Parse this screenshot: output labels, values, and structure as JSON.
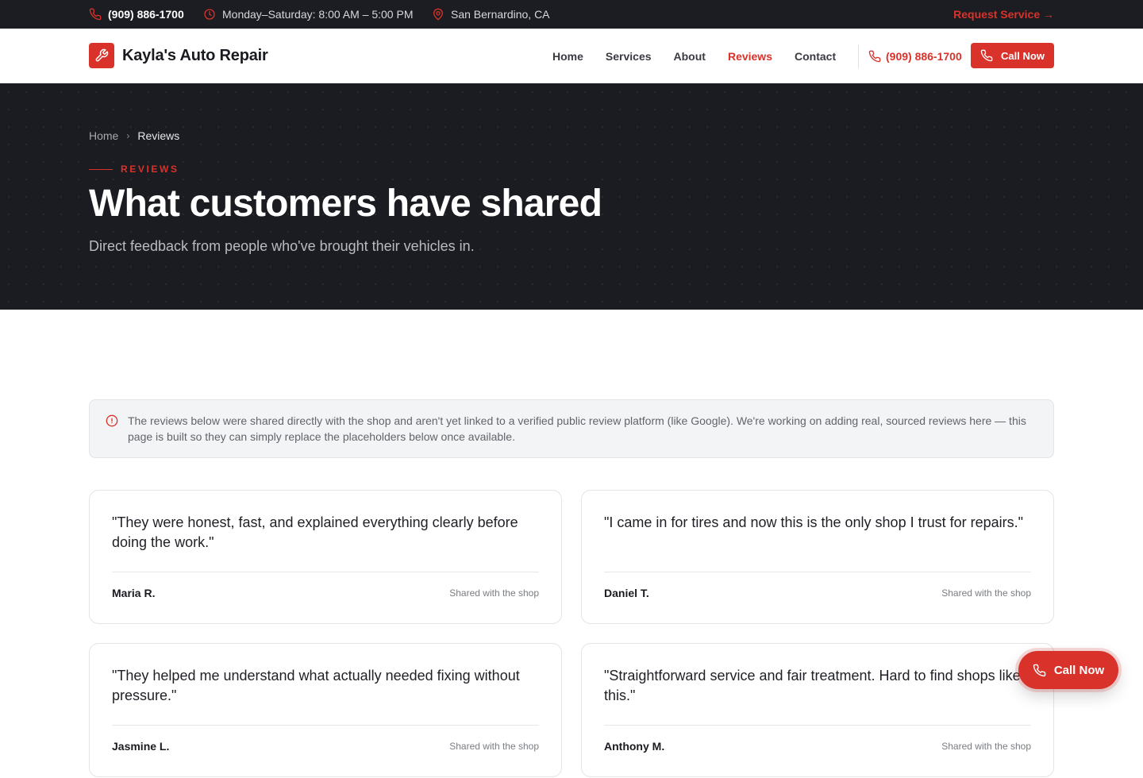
{
  "topbar": {
    "phone": "(909) 886-1700",
    "hours": "Monday–Saturday: 8:00 AM – 5:00 PM",
    "location": "San Bernardino, CA",
    "request_label": "Request Service →"
  },
  "header": {
    "brand": "Kayla's Auto Repair",
    "nav": [
      {
        "label": "Home"
      },
      {
        "label": "Services"
      },
      {
        "label": "About"
      },
      {
        "label": "Reviews"
      },
      {
        "label": "Contact"
      }
    ],
    "active_nav": "Reviews",
    "phone": "(909) 886-1700",
    "call_label": "Call Now"
  },
  "hero": {
    "breadcrumb": {
      "home": "Home",
      "current": "Reviews"
    },
    "eyebrow": "REVIEWS",
    "title": "What customers have shared",
    "subtitle": "Direct feedback from people who've brought their vehicles in."
  },
  "notice": {
    "text": "The reviews below were shared directly with the shop and aren't yet linked to a verified public review platform (like Google). We're working on adding real, sourced reviews here — this page is built so they can simply replace the placeholders below once available."
  },
  "reviews": [
    {
      "quote": "\"They were honest, fast, and explained everything clearly before doing the work.\"",
      "name": "Maria R.",
      "source": "Shared with the shop"
    },
    {
      "quote": "\"I came in for tires and now this is the only shop I trust for repairs.\"",
      "name": "Daniel T.",
      "source": "Shared with the shop"
    },
    {
      "quote": "\"They helped me understand what actually needed fixing without pressure.\"",
      "name": "Jasmine L.",
      "source": "Shared with the shop"
    },
    {
      "quote": "\"Straightforward service and fair treatment. Hard to find shops like this.\"",
      "name": "Anthony M.",
      "source": "Shared with the shop"
    }
  ],
  "floating_call": {
    "label": "Call Now"
  },
  "colors": {
    "accent": "#d8322a",
    "dark": "#1c1d22"
  }
}
